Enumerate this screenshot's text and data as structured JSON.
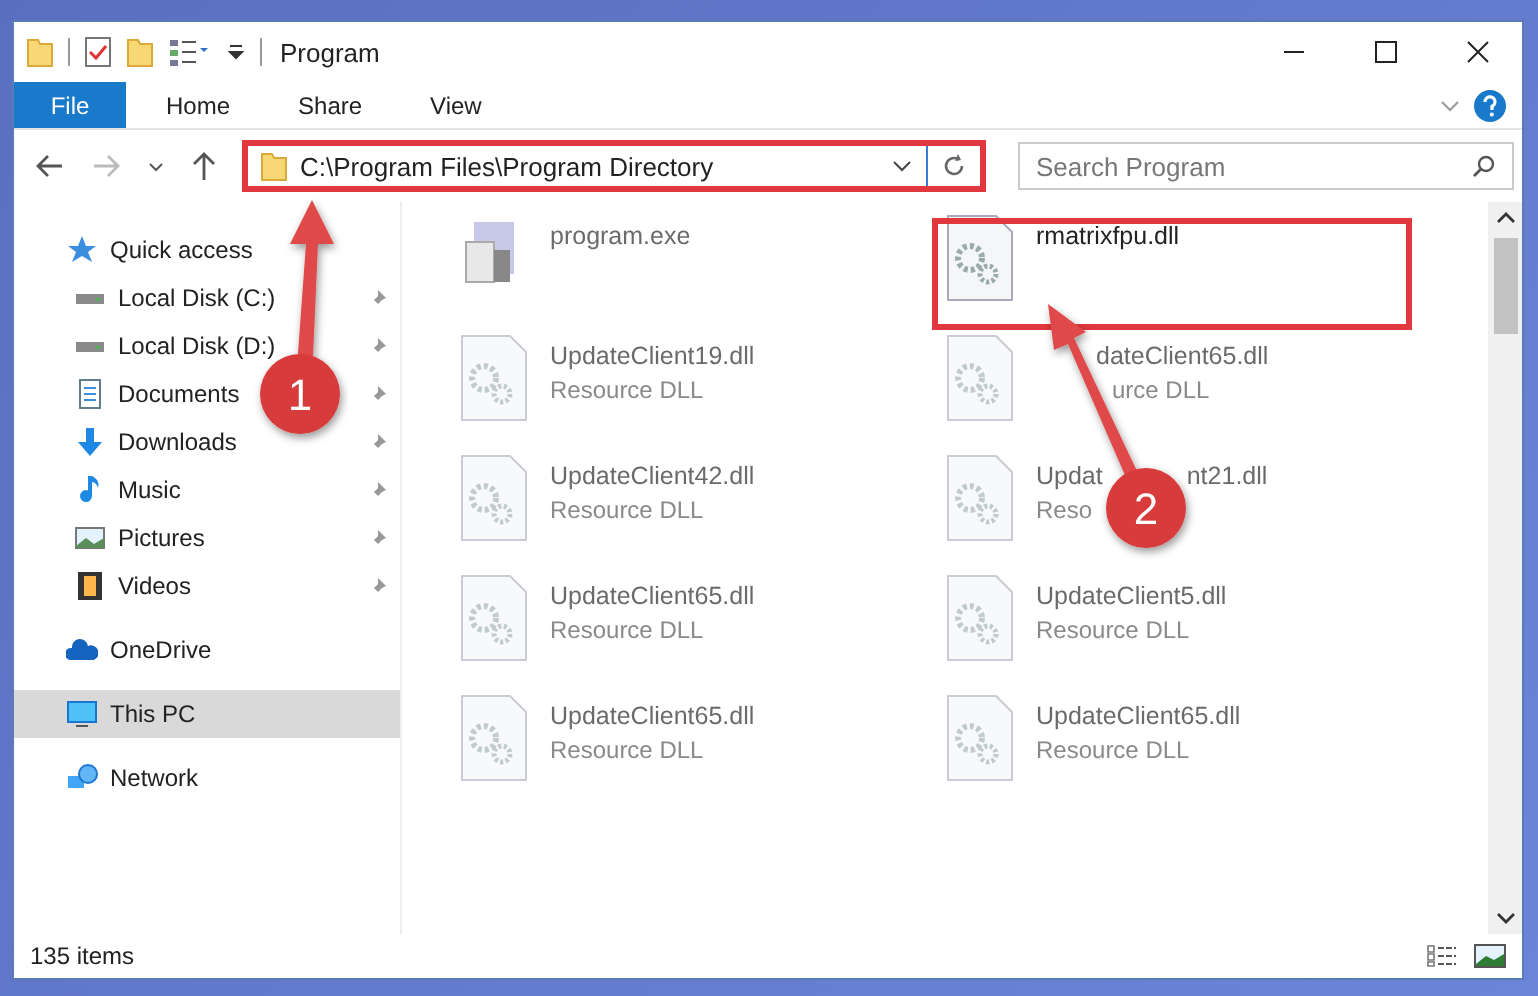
{
  "window": {
    "title": "Program"
  },
  "ribbon_tabs": [
    {
      "label": "File",
      "selected": true
    },
    {
      "label": "Home",
      "selected": false
    },
    {
      "label": "Share",
      "selected": false
    },
    {
      "label": "View",
      "selected": false
    }
  ],
  "address": {
    "path": "C:\\Program Files\\Program Directory",
    "highlighted": true
  },
  "search": {
    "placeholder": "Search Program"
  },
  "sidebar": {
    "items": [
      {
        "label": "Quick access",
        "kind": "star",
        "selected": false,
        "children": [
          {
            "label": "Local Disk (C:)",
            "kind": "drive",
            "pinned": true
          },
          {
            "label": "Local Disk (D:)",
            "kind": "drive",
            "pinned": true
          },
          {
            "label": "Documents",
            "kind": "document",
            "pinned": true
          },
          {
            "label": "Downloads",
            "kind": "download",
            "pinned": true
          },
          {
            "label": "Music",
            "kind": "music",
            "pinned": true
          },
          {
            "label": "Pictures",
            "kind": "picture",
            "pinned": true
          },
          {
            "label": "Videos",
            "kind": "video",
            "pinned": true
          }
        ]
      },
      {
        "label": "OneDrive",
        "kind": "cloud",
        "selected": false
      },
      {
        "label": "This PC",
        "kind": "pc",
        "selected": true
      },
      {
        "label": "Network",
        "kind": "network",
        "selected": false
      }
    ]
  },
  "files": [
    {
      "name": [
        "program.exe"
      ],
      "kind": "exe",
      "highlighted": false
    },
    {
      "name": [
        "rmatrixfpu.dll"
      ],
      "kind": "dll",
      "highlighted": true
    },
    {
      "name": [
        "UpdateClient19.dll"
      ],
      "type": [
        "Resource DLL"
      ],
      "kind": "dll",
      "highlighted": false
    },
    {
      "name": [
        "dateClient65.dll"
      ],
      "type": [
        "urce DLL"
      ],
      "kind": "dll",
      "partly_hidden": true,
      "highlighted": false
    },
    {
      "name": [
        "UpdateClient42.dll"
      ],
      "type": [
        "Resource DLL"
      ],
      "kind": "dll",
      "highlighted": false
    },
    {
      "name": [
        "Updat",
        "nt21.dll"
      ],
      "type": [
        "Reso"
      ],
      "kind": "dll",
      "highlighted": false
    },
    {
      "name": [
        "UpdateClient65.dll"
      ],
      "type": [
        "Resource DLL"
      ],
      "kind": "dll",
      "highlighted": false
    },
    {
      "name": [
        "UpdateClient5.dll"
      ],
      "type": [
        "Resource DLL"
      ],
      "kind": "dll",
      "highlighted": false
    },
    {
      "name": [
        "UpdateClient65.dll"
      ],
      "type": [
        "Resource DLL"
      ],
      "kind": "dll",
      "highlighted": false
    },
    {
      "name": [
        "UpdateClient65.dll"
      ],
      "type": [
        "Resource DLL"
      ],
      "kind": "dll",
      "highlighted": false
    }
  ],
  "status_bar": {
    "count": "135 items"
  },
  "annotations": [
    {
      "label": "1"
    },
    {
      "label": "2"
    }
  ]
}
